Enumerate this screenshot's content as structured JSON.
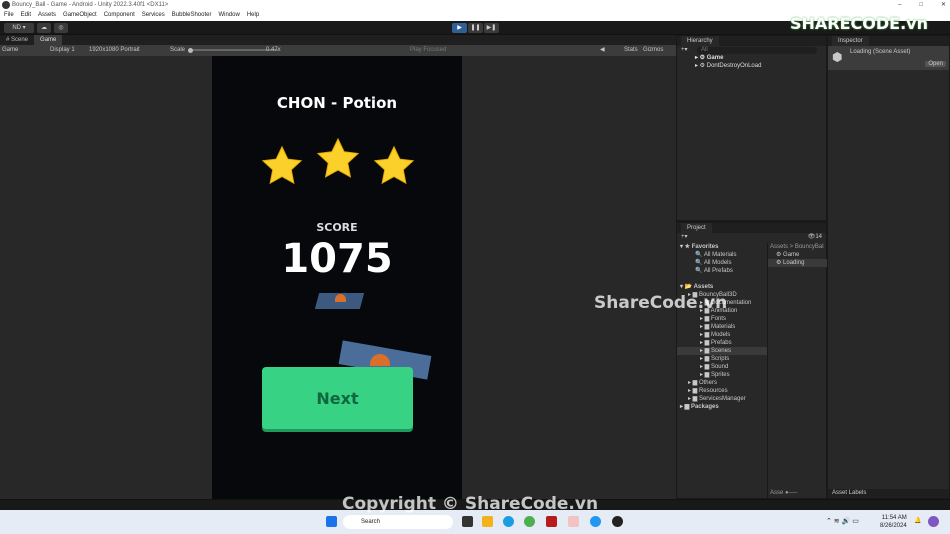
{
  "window": {
    "title": "Bouncy_Ball - Game - Android - Unity 2022.3.40f1 <DX11>",
    "controls": [
      "–",
      "□",
      "✕"
    ]
  },
  "menu": [
    "File",
    "Edit",
    "Assets",
    "GameObject",
    "Component",
    "Services",
    "BubbleShooter",
    "Window",
    "Help"
  ],
  "toolbar": {
    "account": "ND ▾",
    "play_icon": "play-icon",
    "pause_icon": "pause-icon",
    "step_icon": "step-icon"
  },
  "tabs": [
    {
      "label": "# Scene"
    },
    {
      "label": "Game",
      "active": true
    }
  ],
  "gamebar": {
    "view": "Game",
    "display": "Display 1",
    "resolution": "1920x1080 Portrait",
    "scale_label": "Scale",
    "scale_value": "0.47x",
    "play_mode": "Play Focused",
    "stats": "Stats",
    "gizmos": "Gizmos"
  },
  "game": {
    "title": "CHON - Potion",
    "stars": 3,
    "stars_total": 3,
    "score_label": "SCORE",
    "score": "1075",
    "next_button": "Next",
    "colors": {
      "star": "#fcd02a",
      "button": "#37d284",
      "button_text": "#11663f"
    }
  },
  "hierarchy": {
    "title": "Hierarchy",
    "search_placeholder": "All",
    "items": [
      "Game",
      "DontDestroyOnLoad"
    ]
  },
  "inspector": {
    "title": "Inspector",
    "asset": "Loading (Scene Asset)",
    "open_button": "Open",
    "footer": "Asset Labels"
  },
  "project": {
    "title": "Project",
    "hidden_count": "14",
    "favorites_label": "Favorites",
    "favorites": [
      "All Materials",
      "All Models",
      "All Prefabs"
    ],
    "assets_label": "Assets",
    "tree": [
      {
        "label": "BouncyBall3D",
        "depth": 1
      },
      {
        "label": "Documentation",
        "depth": 2
      },
      {
        "label": "Animation",
        "depth": 2
      },
      {
        "label": "Fonts",
        "depth": 2
      },
      {
        "label": "Materials",
        "depth": 2
      },
      {
        "label": "Models",
        "depth": 2
      },
      {
        "label": "Prefabs",
        "depth": 2
      },
      {
        "label": "Scenes",
        "depth": 2,
        "selected": true
      },
      {
        "label": "Scripts",
        "depth": 2
      },
      {
        "label": "Sound",
        "depth": 2
      },
      {
        "label": "Sprites",
        "depth": 2
      },
      {
        "label": "Others",
        "depth": 1
      },
      {
        "label": "Resources",
        "depth": 1
      },
      {
        "label": "ServicesManager",
        "depth": 1
      }
    ],
    "packages_label": "Packages",
    "breadcrumb": "Assets > BouncyBal",
    "files": [
      {
        "label": "Game"
      },
      {
        "label": "Loading",
        "selected": true
      }
    ],
    "slider_label": "Asse"
  },
  "taskbar": {
    "search": "Search",
    "time": "11:54 AM",
    "date": "8/26/2024"
  },
  "watermark": {
    "logo": "SHARECODE.vn",
    "center": "ShareCode.vn",
    "copyright": "Copyright © ShareCode.vn"
  }
}
